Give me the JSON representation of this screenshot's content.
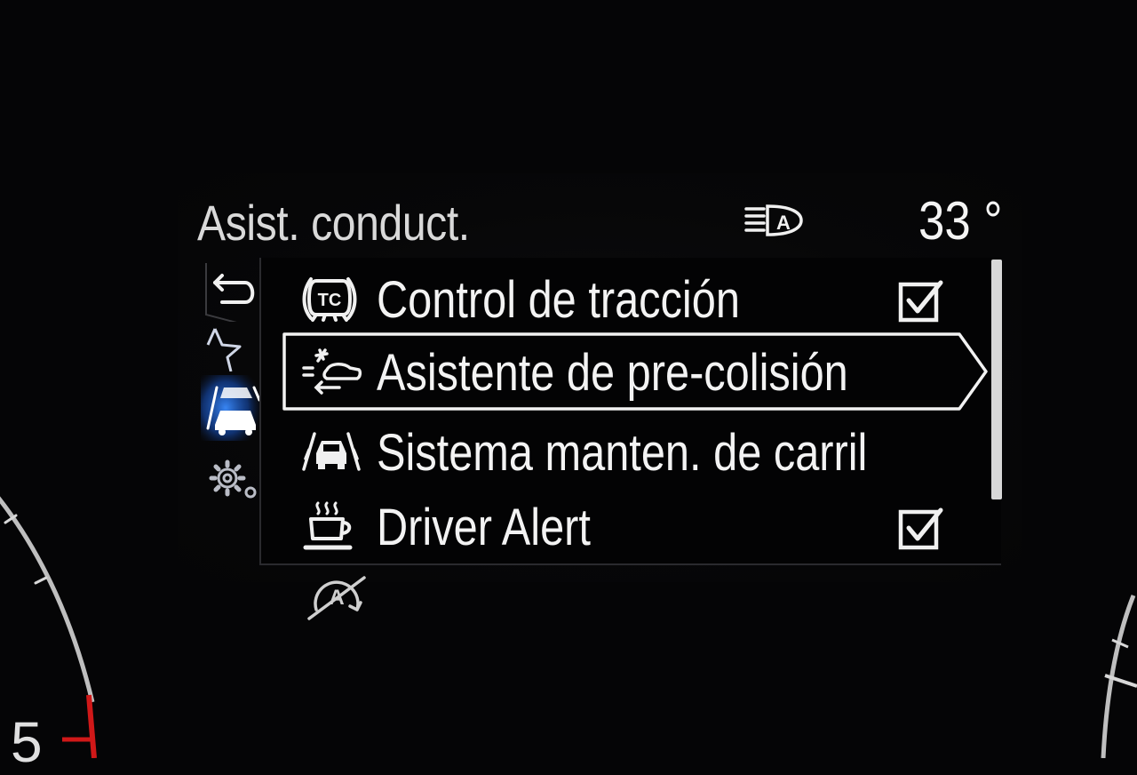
{
  "header": {
    "title": "Asist. conduct.",
    "temperature": "33 °",
    "headlight_icon": "auto-high-beam-icon"
  },
  "side_tabs": [
    {
      "icon": "back-arrow-icon"
    },
    {
      "icon": "star-icon"
    },
    {
      "icon": "driver-assist-icon",
      "active": true
    },
    {
      "icon": "settings-gear-icon"
    }
  ],
  "menu": {
    "items": [
      {
        "label": "Control de tracción",
        "icon": "traction-control-icon",
        "checked": true,
        "selected": false
      },
      {
        "label": "Asistente de pre-colisión",
        "icon": "pre-collision-icon",
        "checked": null,
        "selected": true
      },
      {
        "label": "Sistema manten. de carril",
        "icon": "lane-keeping-icon",
        "checked": null,
        "selected": false
      },
      {
        "label": "Driver Alert",
        "icon": "driver-alert-coffee-icon",
        "checked": true,
        "selected": false
      }
    ]
  },
  "footer": {
    "icon": "auto-start-stop-off-icon"
  },
  "gauge": {
    "digit": "5"
  },
  "colors": {
    "text": "#f3f3f3",
    "accent_blue": "#2f7fff",
    "needle_red": "#d01818",
    "background": "#050506"
  }
}
